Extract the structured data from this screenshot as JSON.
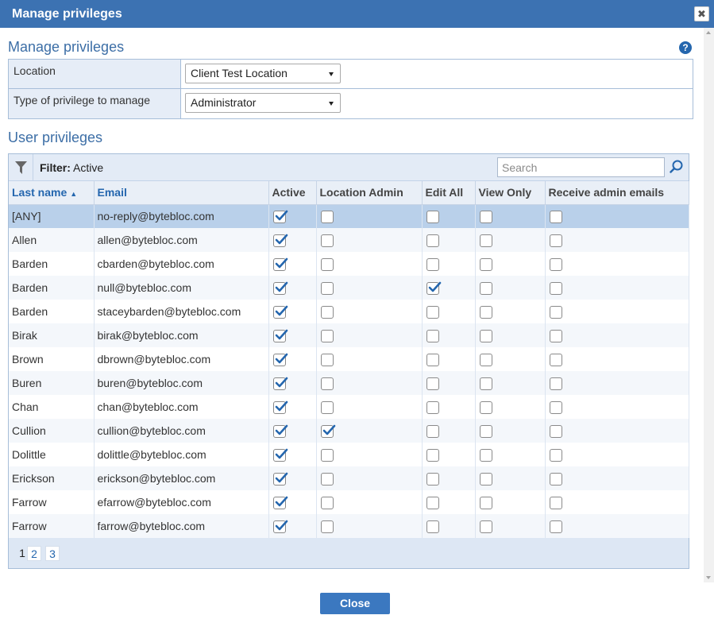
{
  "window": {
    "title": "Manage privileges"
  },
  "header": {
    "heading": "Manage privileges",
    "help_icon": "question-circle-icon"
  },
  "settings": {
    "location_label": "Location",
    "location_value": "Client Test Location",
    "type_label": "Type of privilege to manage",
    "type_value": "Administrator"
  },
  "user_privileges": {
    "heading": "User privileges",
    "filter_label": "Filter:",
    "filter_value": "Active",
    "search_placeholder": "Search",
    "columns": [
      "Last name",
      "Email",
      "Active",
      "Location Admin",
      "Edit All",
      "View Only",
      "Receive admin emails"
    ],
    "sort_column": "Last name",
    "sort_direction": "ascending",
    "rows": [
      {
        "last_name": "[ANY]",
        "email": "no-reply@bytebloc.com",
        "active": true,
        "location_admin": false,
        "edit_all": false,
        "view_only": false,
        "receive_admin_emails": false,
        "selected": true
      },
      {
        "last_name": "Allen",
        "email": "allen@bytebloc.com",
        "active": true,
        "location_admin": false,
        "edit_all": false,
        "view_only": false,
        "receive_admin_emails": false
      },
      {
        "last_name": "Barden",
        "email": "cbarden@bytebloc.com",
        "active": true,
        "location_admin": false,
        "edit_all": false,
        "view_only": false,
        "receive_admin_emails": false
      },
      {
        "last_name": "Barden",
        "email": "null@bytebloc.com",
        "active": true,
        "location_admin": false,
        "edit_all": true,
        "view_only": false,
        "receive_admin_emails": false
      },
      {
        "last_name": "Barden",
        "email": "staceybarden@bytebloc.com",
        "active": true,
        "location_admin": false,
        "edit_all": false,
        "view_only": false,
        "receive_admin_emails": false
      },
      {
        "last_name": "Birak",
        "email": "birak@bytebloc.com",
        "active": true,
        "location_admin": false,
        "edit_all": false,
        "view_only": false,
        "receive_admin_emails": false
      },
      {
        "last_name": "Brown",
        "email": "dbrown@bytebloc.com",
        "active": true,
        "location_admin": false,
        "edit_all": false,
        "view_only": false,
        "receive_admin_emails": false
      },
      {
        "last_name": "Buren",
        "email": "buren@bytebloc.com",
        "active": true,
        "location_admin": false,
        "edit_all": false,
        "view_only": false,
        "receive_admin_emails": false
      },
      {
        "last_name": "Chan",
        "email": "chan@bytebloc.com",
        "active": true,
        "location_admin": false,
        "edit_all": false,
        "view_only": false,
        "receive_admin_emails": false
      },
      {
        "last_name": "Cullion",
        "email": "cullion@bytebloc.com",
        "active": true,
        "location_admin": true,
        "edit_all": false,
        "view_only": false,
        "receive_admin_emails": false
      },
      {
        "last_name": "Dolittle",
        "email": "dolittle@bytebloc.com",
        "active": true,
        "location_admin": false,
        "edit_all": false,
        "view_only": false,
        "receive_admin_emails": false
      },
      {
        "last_name": "Erickson",
        "email": "erickson@bytebloc.com",
        "active": true,
        "location_admin": false,
        "edit_all": false,
        "view_only": false,
        "receive_admin_emails": false
      },
      {
        "last_name": "Farrow",
        "email": "efarrow@bytebloc.com",
        "active": true,
        "location_admin": false,
        "edit_all": false,
        "view_only": false,
        "receive_admin_emails": false
      },
      {
        "last_name": "Farrow",
        "email": "farrow@bytebloc.com",
        "active": true,
        "location_admin": false,
        "edit_all": false,
        "view_only": false,
        "receive_admin_emails": false
      }
    ],
    "pages": [
      "1",
      "2",
      "3"
    ],
    "current_page": "1"
  },
  "footer": {
    "close_label": "Close"
  },
  "colors": {
    "brand": "#3c72b2",
    "heading": "#3c6ea6",
    "link": "#2466ae",
    "selected_row": "#b9d0ea"
  }
}
